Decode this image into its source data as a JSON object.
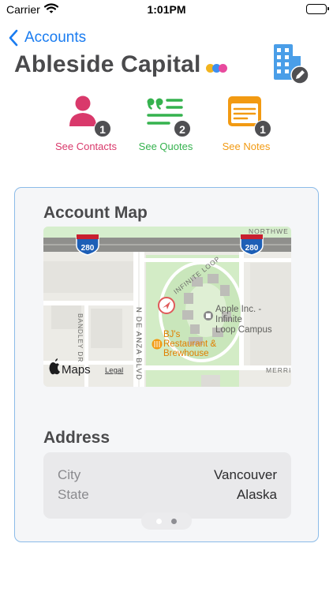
{
  "status_bar": {
    "carrier": "Carrier",
    "time": "1:01PM"
  },
  "nav": {
    "back_label": "Accounts"
  },
  "account": {
    "name": "Ableside Capital",
    "tag_colors": [
      "#f2b41e",
      "#3d8ff0",
      "#e84a9e"
    ]
  },
  "actions": [
    {
      "label": "See Contacts",
      "count": "1",
      "color": "#d9396b",
      "icon": "person-icon"
    },
    {
      "label": "See Quotes",
      "count": "2",
      "color": "#35b24e",
      "icon": "quote-list-icon"
    },
    {
      "label": "See Notes",
      "count": "1",
      "color": "#f29a12",
      "icon": "notes-icon"
    }
  ],
  "map_section": {
    "title": "Account Map",
    "labels": {
      "interstate_num": "280",
      "northwest": "NORTHWE",
      "infinite_loop": "INFINITE LOOP",
      "bandley": "BANDLEY DR",
      "de_anza": "N DE ANZA BLVD",
      "merritt": "MERRITT",
      "poi_apple": [
        "Apple Inc. -",
        "Infinite",
        "Loop Campus"
      ],
      "poi_bjs": [
        "BJ's",
        "Restaurant &",
        "Brewhouse"
      ],
      "brand": "Maps",
      "legal": "Legal"
    }
  },
  "address_section": {
    "title": "Address",
    "rows": [
      {
        "key": "City",
        "value": "Vancouver"
      },
      {
        "key": "State",
        "value": "Alaska"
      }
    ]
  },
  "pager": {
    "pages": 2,
    "current": 2
  },
  "colors": {
    "accent": "#1a7cf0",
    "card_border": "#8bbbe8",
    "building": "#4a9ee8"
  }
}
